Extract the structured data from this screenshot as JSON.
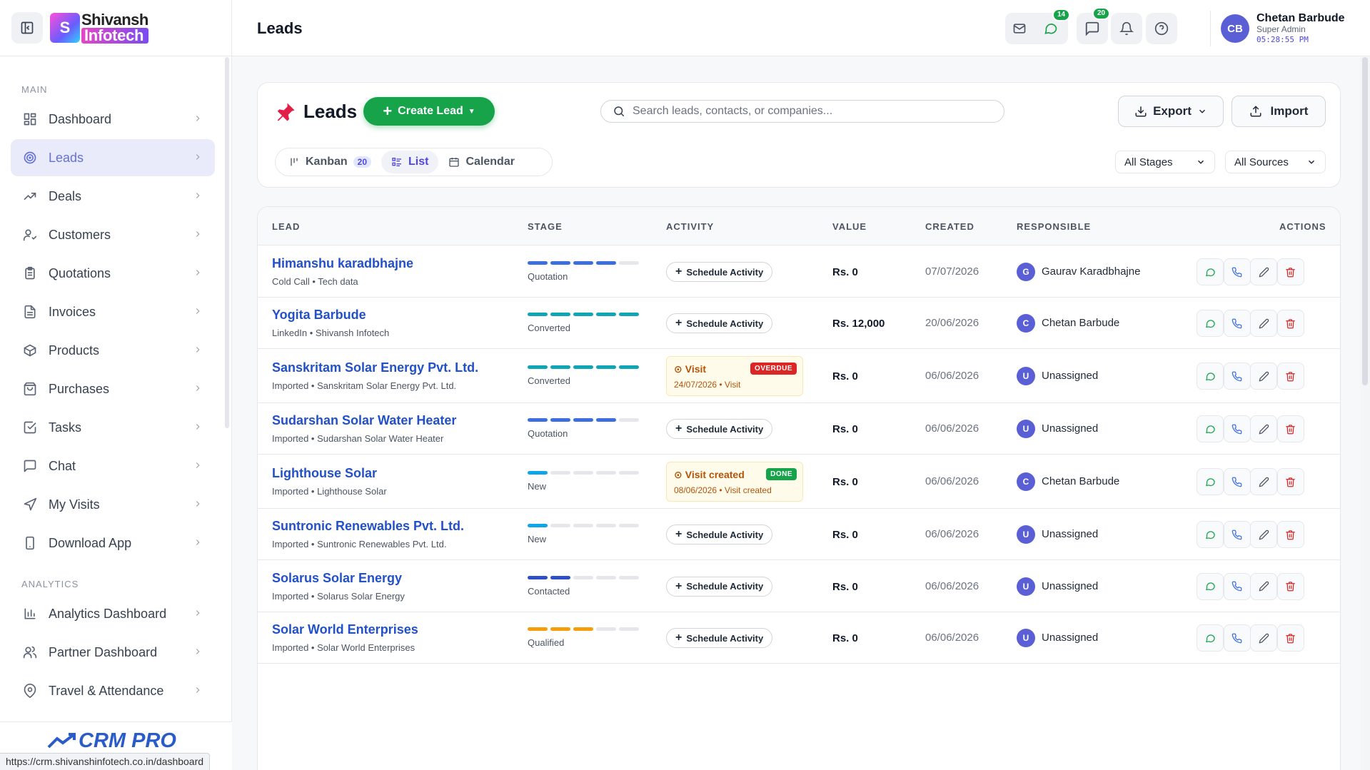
{
  "sidebar": {
    "brand": {
      "line1": "Shivansh",
      "line2": "Infotech"
    },
    "section_main": "MAIN",
    "section_analytics": "ANALYTICS",
    "main_items": [
      {
        "label": "Dashboard",
        "icon": "dashboard-icon"
      },
      {
        "label": "Leads",
        "icon": "target-icon",
        "active": true
      },
      {
        "label": "Deals",
        "icon": "trend-icon"
      },
      {
        "label": "Customers",
        "icon": "user-check-icon"
      },
      {
        "label": "Quotations",
        "icon": "clipboard-icon"
      },
      {
        "label": "Invoices",
        "icon": "file-text-icon"
      },
      {
        "label": "Products",
        "icon": "box-icon"
      },
      {
        "label": "Purchases",
        "icon": "shopping-bag-icon"
      },
      {
        "label": "Tasks",
        "icon": "checkbox-icon"
      },
      {
        "label": "Chat",
        "icon": "chat-icon"
      },
      {
        "label": "My Visits",
        "icon": "navigation-icon"
      },
      {
        "label": "Download App",
        "icon": "phone-icon"
      }
    ],
    "analytics_items": [
      {
        "label": "Analytics Dashboard",
        "icon": "bar-chart-icon"
      },
      {
        "label": "Partner Dashboard",
        "icon": "users-icon"
      },
      {
        "label": "Travel & Attendance",
        "icon": "map-pin-icon"
      }
    ],
    "footer_brand": "CRM PRO",
    "status_url": "https://crm.shivanshinfotech.co.in/dashboard"
  },
  "topbar": {
    "title": "Leads",
    "badges": {
      "whatsapp": "14",
      "messages": "20"
    },
    "user": {
      "initials": "CB",
      "name": "Chetan Barbude",
      "role": "Super Admin",
      "time": "05:28:55 PM"
    }
  },
  "leads_card": {
    "title": "Leads",
    "create_label": "Create Lead",
    "search_placeholder": "Search leads, contacts, or companies...",
    "export_label": "Export",
    "import_label": "Import",
    "views": {
      "kanban": "Kanban",
      "kanban_count": "20",
      "list": "List",
      "calendar": "Calendar"
    },
    "stage_filter": "All Stages",
    "source_filter": "All Sources"
  },
  "table": {
    "headers": {
      "lead": "LEAD",
      "stage": "STAGE",
      "activity": "ACTIVITY",
      "value": "VALUE",
      "created": "CREATED",
      "responsible": "RESPONSIBLE",
      "actions": "ACTIONS"
    },
    "schedule_label": "Schedule Activity",
    "stage_colors": {
      "Quotation": "#3b6fe0",
      "Converted": "#0ea5b7",
      "New": "#0ea5e9",
      "Contacted": "#2f4fc9",
      "Qualified": "#f59e0b"
    },
    "rows": [
      {
        "name": "Himanshu karadbhajne",
        "sub": "Cold Call • Tech data",
        "stage": "Quotation",
        "stage_level": 4,
        "activity": null,
        "value": "Rs. 0",
        "created": "07/07/2026",
        "resp_initial": "G",
        "resp": "Gaurav Karadbhajne"
      },
      {
        "name": "Yogita Barbude",
        "sub": "LinkedIn • Shivansh Infotech",
        "stage": "Converted",
        "stage_level": 5,
        "activity": null,
        "value": "Rs. 12,000",
        "created": "20/06/2026",
        "resp_initial": "C",
        "resp": "Chetan Barbude"
      },
      {
        "name": "Sanskritam Solar Energy Pvt. Ltd.",
        "sub": "Imported • Sanskritam Solar Energy Pvt. Ltd.",
        "stage": "Converted",
        "stage_level": 5,
        "activity": {
          "title": "Visit",
          "sub": "24/07/2026 • Visit",
          "tag": "OVERDUE",
          "tag_type": "overdue"
        },
        "value": "Rs. 0",
        "created": "06/06/2026",
        "resp_initial": "U",
        "resp": "Unassigned"
      },
      {
        "name": "Sudarshan Solar Water Heater",
        "sub": "Imported • Sudarshan Solar Water Heater",
        "stage": "Quotation",
        "stage_level": 4,
        "activity": null,
        "value": "Rs. 0",
        "created": "06/06/2026",
        "resp_initial": "U",
        "resp": "Unassigned"
      },
      {
        "name": "Lighthouse Solar",
        "sub": "Imported • Lighthouse Solar",
        "stage": "New",
        "stage_level": 1,
        "activity": {
          "title": "Visit created",
          "sub": "08/06/2026 • Visit created",
          "tag": "DONE",
          "tag_type": "done"
        },
        "value": "Rs. 0",
        "created": "06/06/2026",
        "resp_initial": "C",
        "resp": "Chetan Barbude"
      },
      {
        "name": "Suntronic Renewables Pvt. Ltd.",
        "sub": "Imported • Suntronic Renewables Pvt. Ltd.",
        "stage": "New",
        "stage_level": 1,
        "activity": null,
        "value": "Rs. 0",
        "created": "06/06/2026",
        "resp_initial": "U",
        "resp": "Unassigned"
      },
      {
        "name": "Solarus Solar Energy",
        "sub": "Imported • Solarus Solar Energy",
        "stage": "Contacted",
        "stage_level": 2,
        "activity": null,
        "value": "Rs. 0",
        "created": "06/06/2026",
        "resp_initial": "U",
        "resp": "Unassigned"
      },
      {
        "name": "Solar World Enterprises",
        "sub": "Imported • Solar World Enterprises",
        "stage": "Qualified",
        "stage_level": 3,
        "activity": null,
        "value": "Rs. 0",
        "created": "06/06/2026",
        "resp_initial": "U",
        "resp": "Unassigned"
      }
    ]
  }
}
